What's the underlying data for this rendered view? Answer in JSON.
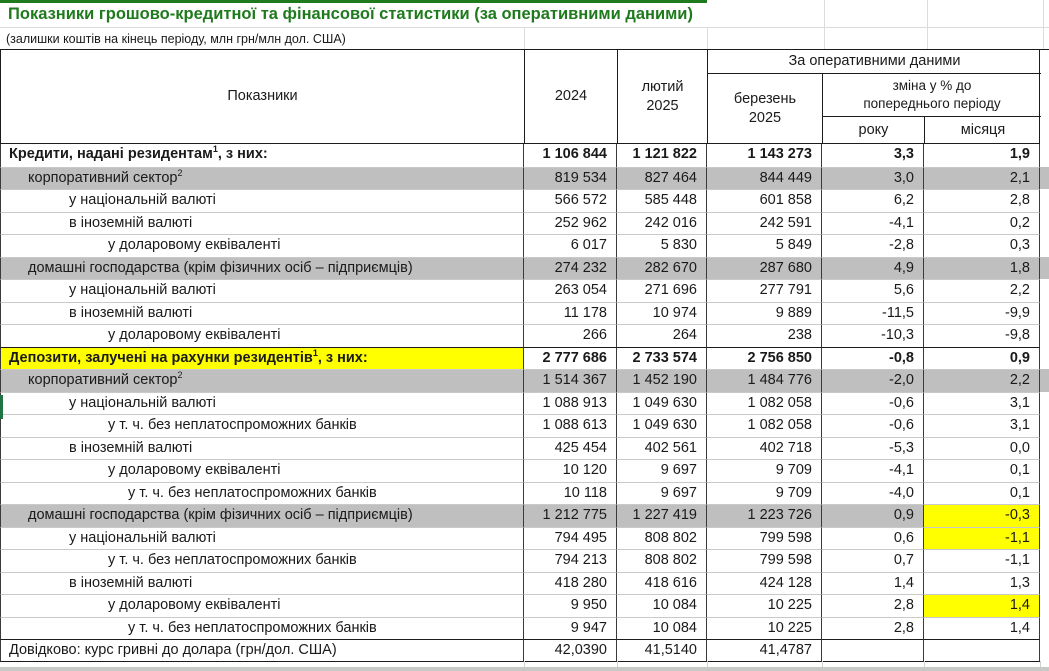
{
  "title": "Показники грошово-кредитної та фінансової статистики (за оперативними даними)",
  "subtitle": "(залишки коштів на кінець періоду, млн грн/млн дол. США)",
  "theme": {
    "title_green": "#1f7a1e",
    "band_gray": "#bfbfbf",
    "highlight_yellow": "#ffff00",
    "selection_green": "#217346"
  },
  "header": {
    "indicators": "Показники",
    "year_2024": "2024",
    "feb_line1": "лютий",
    "feb_line2": "2025",
    "operational": "За оперативними даними",
    "mar_line1": "березень",
    "mar_line2": "2025",
    "change_line1": "зміна у % до",
    "change_line2": "попереднього періоду",
    "year_col": "року",
    "month_col": "місяця"
  },
  "rows": [
    {
      "indent": 0,
      "bold": true,
      "border_top": "none",
      "label": "Кредити, надані резидентам",
      "sup": "1",
      "suffix": ", з них:",
      "values": [
        "1 106 844",
        "1 121 822",
        "1 143 273",
        "3,3",
        "1,9"
      ]
    },
    {
      "indent": 1,
      "bg": "gray",
      "label": "корпоративний сектор",
      "sup": "2",
      "suffix": "",
      "values": [
        "819 534",
        "827 464",
        "844 449",
        "3,0",
        "2,1"
      ]
    },
    {
      "indent": 2,
      "label": "у національній валюті",
      "values": [
        "566 572",
        "585 448",
        "601 858",
        "6,2",
        "2,8"
      ]
    },
    {
      "indent": 2,
      "label": "в іноземній валюті",
      "values": [
        "252 962",
        "242 016",
        "242 591",
        "-4,1",
        "0,2"
      ]
    },
    {
      "indent": 3,
      "label": "у доларовому еквіваленті",
      "values": [
        "6 017",
        "5 830",
        "5 849",
        "-2,8",
        "0,3"
      ]
    },
    {
      "indent": 1,
      "bg": "gray",
      "label": "домашні господарства (крім фізичних осіб – підприємців)",
      "values": [
        "274 232",
        "282 670",
        "287 680",
        "4,9",
        "1,8"
      ]
    },
    {
      "indent": 2,
      "label": "у національній валюті",
      "values": [
        "263 054",
        "271 696",
        "277 791",
        "5,6",
        "2,2"
      ]
    },
    {
      "indent": 2,
      "label": "в іноземній валюті",
      "values": [
        "11 178",
        "10 974",
        "9 889",
        "-11,5",
        "-9,9"
      ]
    },
    {
      "indent": 3,
      "label": "у доларовому еквіваленті",
      "values": [
        "266",
        "264",
        "238",
        "-10,3",
        "-9,8"
      ]
    },
    {
      "indent": 0,
      "bold": true,
      "border_top": "dark",
      "label_bg": "yellow",
      "label": "Депозити, залучені на рахунки резидентів",
      "sup": "1",
      "suffix": ", з них:",
      "values": [
        "2 777 686",
        "2 733 574",
        "2 756 850",
        "-0,8",
        "0,9"
      ]
    },
    {
      "indent": 1,
      "bg": "gray",
      "label": "корпоративний сектор",
      "sup": "2",
      "suffix": "",
      "values": [
        "1 514 367",
        "1 452 190",
        "1 484 776",
        "-2,0",
        "2,2"
      ]
    },
    {
      "indent": 2,
      "label": "у національній валюті",
      "values": [
        "1 088 913",
        "1 049 630",
        "1 082 058",
        "-0,6",
        "3,1"
      ]
    },
    {
      "indent": 3,
      "label": "у т. ч. без неплатоспроможних банків",
      "values": [
        "1 088 613",
        "1 049 630",
        "1 082 058",
        "-0,6",
        "3,1"
      ]
    },
    {
      "indent": 2,
      "label": "в іноземній валюті",
      "values": [
        "425 454",
        "402 561",
        "402 718",
        "-5,3",
        "0,0"
      ]
    },
    {
      "indent": 3,
      "label": "у доларовому еквіваленті",
      "values": [
        "10 120",
        "9 697",
        "9 709",
        "-4,1",
        "0,1"
      ]
    },
    {
      "indent": 4,
      "label": "у т. ч. без неплатоспроможних банків",
      "values": [
        "10 118",
        "9 697",
        "9 709",
        "-4,0",
        "0,1"
      ]
    },
    {
      "indent": 1,
      "bg": "gray",
      "strip_bg": "white",
      "mom_bg": "yellow",
      "label": "домашні господарства (крім фізичних осіб – підприємців)",
      "values": [
        "1 212 775",
        "1 227 419",
        "1 223 726",
        "0,9",
        "-0,3"
      ]
    },
    {
      "indent": 2,
      "mom_bg": "yellow",
      "label": "у національній валюті",
      "values": [
        "794 495",
        "808 802",
        "799 598",
        "0,6",
        "-1,1"
      ]
    },
    {
      "indent": 3,
      "label": "у т. ч. без неплатоспроможних банків",
      "values": [
        "794 213",
        "808 802",
        "799 598",
        "0,7",
        "-1,1"
      ]
    },
    {
      "indent": 2,
      "label": "в іноземній валюті",
      "values": [
        "418 280",
        "418 616",
        "424 128",
        "1,4",
        "1,3"
      ]
    },
    {
      "indent": 3,
      "mom_bg": "yellow",
      "label": "у доларовому еквіваленті",
      "values": [
        "9 950",
        "10 084",
        "10 225",
        "2,8",
        "1,4"
      ]
    },
    {
      "indent": 4,
      "label": "у т. ч. без неплатоспроможних банків",
      "values": [
        "9 947",
        "10 084",
        "10 225",
        "2,8",
        "1,4"
      ]
    },
    {
      "indent": 0,
      "border_top": "dark",
      "label": "Довідково: курс гривні до долара (грн/дол. США)",
      "values": [
        "42,0390",
        "41,5140",
        "41,4787",
        "",
        ""
      ]
    }
  ]
}
